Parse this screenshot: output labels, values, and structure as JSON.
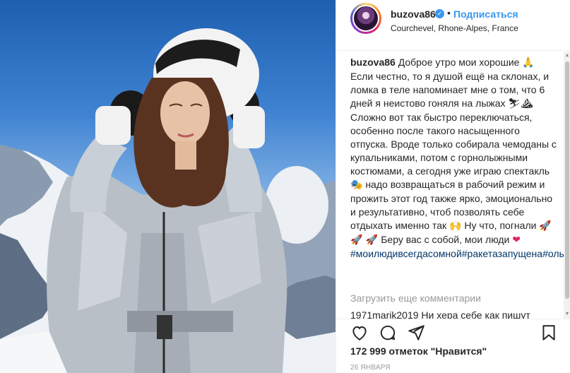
{
  "post": {
    "username": "buzova86",
    "verified_icon": "verified-badge-icon",
    "follow_label": "Подписаться",
    "location": "Courchevel, Rhone-Alpes, France",
    "separator": "•"
  },
  "caption": {
    "username": "buzova86",
    "line1": "Доброе утро мои хорошие",
    "emoji1": "🙏",
    "text2": "Если честно, то я душой ещё на склонах, и ломка в теле напоминает мне о том, что 6 дней я неистово гоняля на лыжах",
    "emoji2": "⛷⛰",
    "text3": "Сложно вот так быстро переключаться, особенно после такого насыщенного отпуска. Вроде только собирала чемоданы с купальниками, потом с горнолыжными костюмами, а сегодня уже играю спектакль",
    "emoji3": "🎭",
    "text4": "надо возвращаться в рабочий режим и прожить этот год также ярко, эмоционально и результативно, чтоб позволять себе отдыхать именно так",
    "emoji4": "🙌",
    "text5": "Ну что, погнали",
    "emoji5": "🚀 🚀 🚀",
    "text6": "Беру вас с собой, мои люди",
    "emoji6": "❤",
    "hashtags": "#моилюдивсегдасомной#ракетазапущена#ольгабузова#courchevel"
  },
  "comments": {
    "load_more": "Загрузить еще комментарии",
    "next_comment": "1971marik2019 Ни хера себе как пишут"
  },
  "actions": {
    "like_icon": "heart-icon",
    "comment_icon": "comment-icon",
    "share_icon": "share-icon",
    "save_icon": "bookmark-icon"
  },
  "likes": "172 999 отметок \"Нравится\"",
  "date": "26 ЯНВАРЯ"
}
